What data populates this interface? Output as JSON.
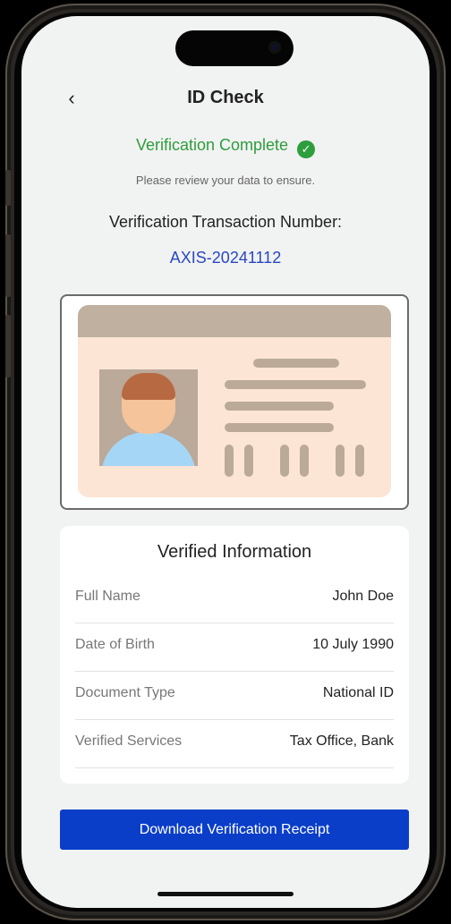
{
  "header": {
    "back_icon": "chevron-left-icon",
    "title": "ID Check"
  },
  "status": {
    "text": "Verification Complete",
    "icon": "check-circle-icon",
    "color": "#2e9d3c"
  },
  "subtitle": "Please review your data to ensure.",
  "transaction": {
    "label": "Verification Transaction Number:",
    "number": "AXIS-20241112"
  },
  "id_card": {
    "illustration": "id-card-illustration"
  },
  "verified_info": {
    "title": "Verified Information",
    "rows": [
      {
        "label": "Full Name",
        "value": "John Doe"
      },
      {
        "label": "Date of Birth",
        "value": "10 July 1990"
      },
      {
        "label": "Document Type",
        "value": "National ID"
      },
      {
        "label": "Verified Services",
        "value": "Tax Office, Bank"
      }
    ]
  },
  "download_button": {
    "label": "Download Verification Receipt",
    "color": "#0a3ec9"
  }
}
